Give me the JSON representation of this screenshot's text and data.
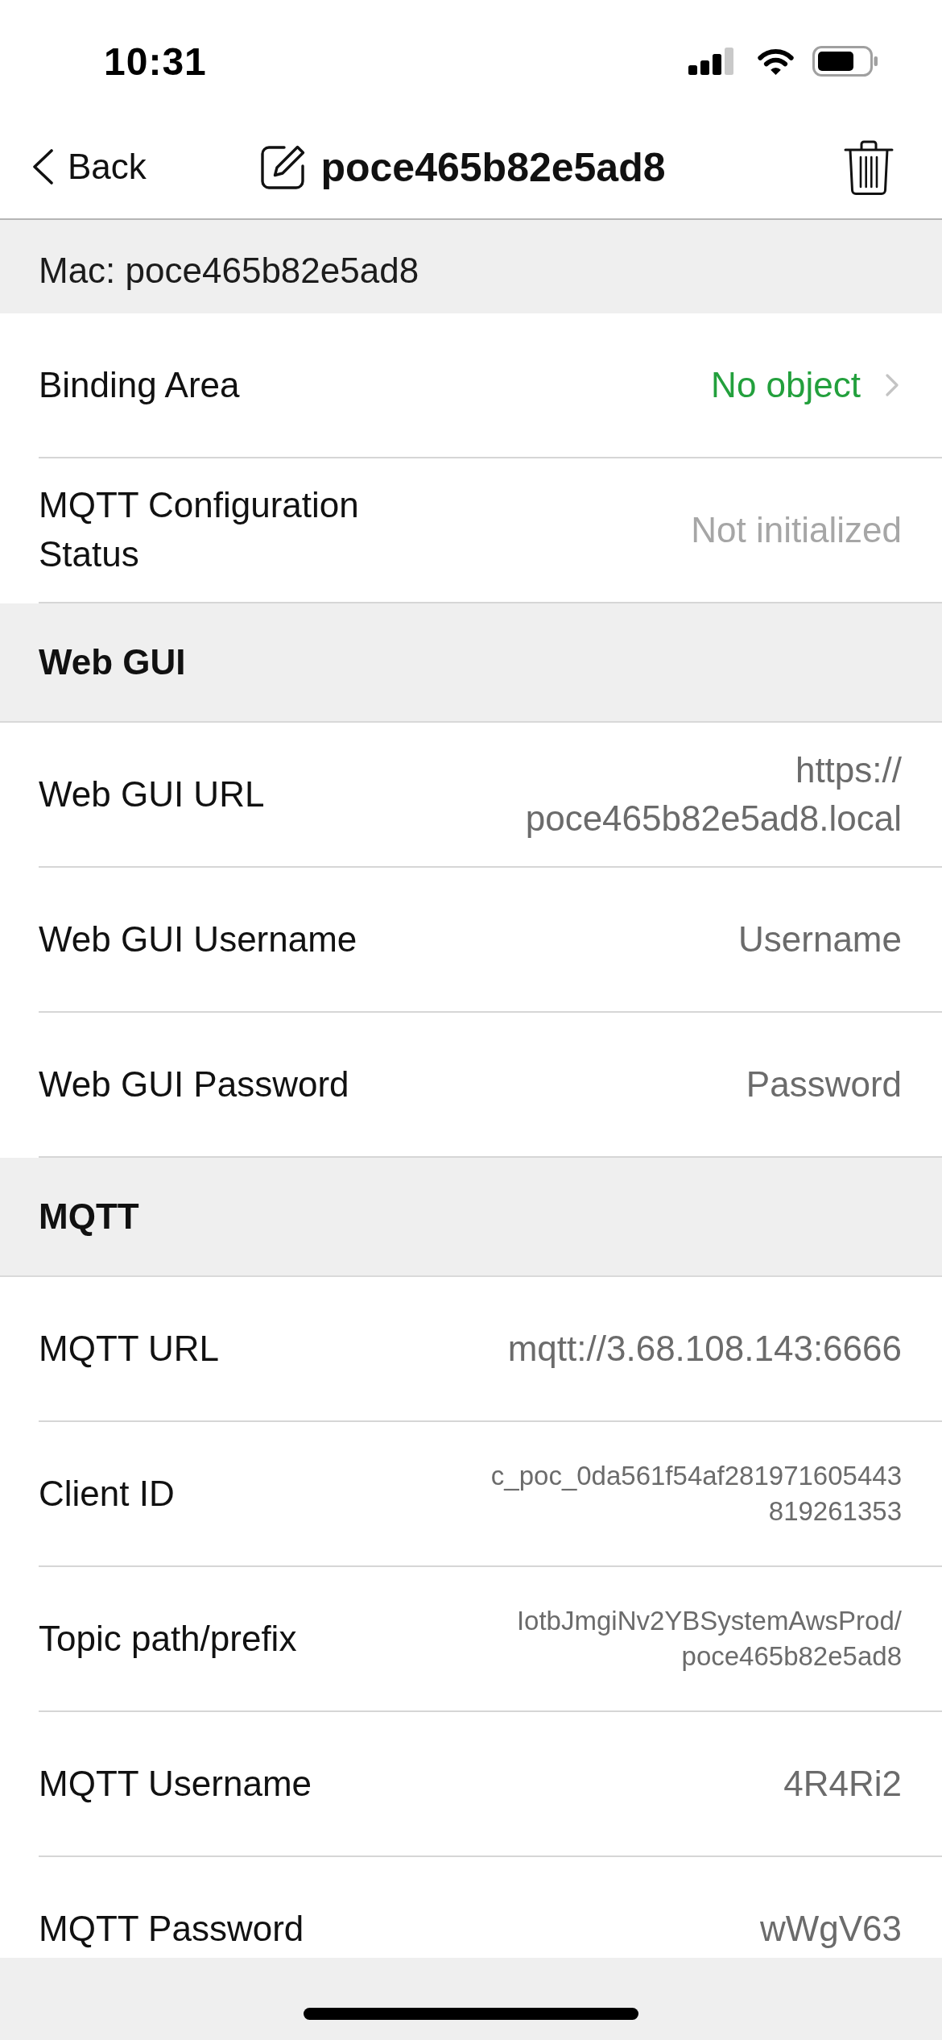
{
  "status_bar": {
    "time": "10:31"
  },
  "nav_bar": {
    "back": "Back",
    "title": "poce465b82e5ad8"
  },
  "mac": "Mac: poce465b82e5ad8",
  "sections": [
    {
      "rows": [
        {
          "label": "Binding Area",
          "value": "No object",
          "kind": "link"
        },
        {
          "label": "MQTT Configuration Status",
          "value": "Not initialized",
          "kind": "status"
        }
      ]
    },
    {
      "title": "Web GUI",
      "rows": [
        {
          "label": "Web GUI URL",
          "value": "https://poce465b82e5ad8.local",
          "kind": "text"
        },
        {
          "label": "Web GUI Username",
          "value": "Username",
          "kind": "text"
        },
        {
          "label": "Web GUI Password",
          "value": "Password",
          "kind": "text"
        }
      ]
    },
    {
      "title": "MQTT",
      "rows": [
        {
          "label": "MQTT URL",
          "value": "mqtt://3.68.108.143:6666",
          "kind": "text"
        },
        {
          "label": "Client ID",
          "value": "c_poc_0da561f54af281971605443819261353",
          "kind": "long"
        },
        {
          "label": "Topic path/prefix",
          "value": "IotbJmgiNv2YBSystemAwsProd/poce465b82e5ad8",
          "kind": "long"
        },
        {
          "label": "MQTT Username",
          "value": "4R4Ri2",
          "kind": "text"
        },
        {
          "label": "MQTT Password",
          "value": "wWgV63",
          "kind": "text"
        }
      ]
    }
  ]
}
